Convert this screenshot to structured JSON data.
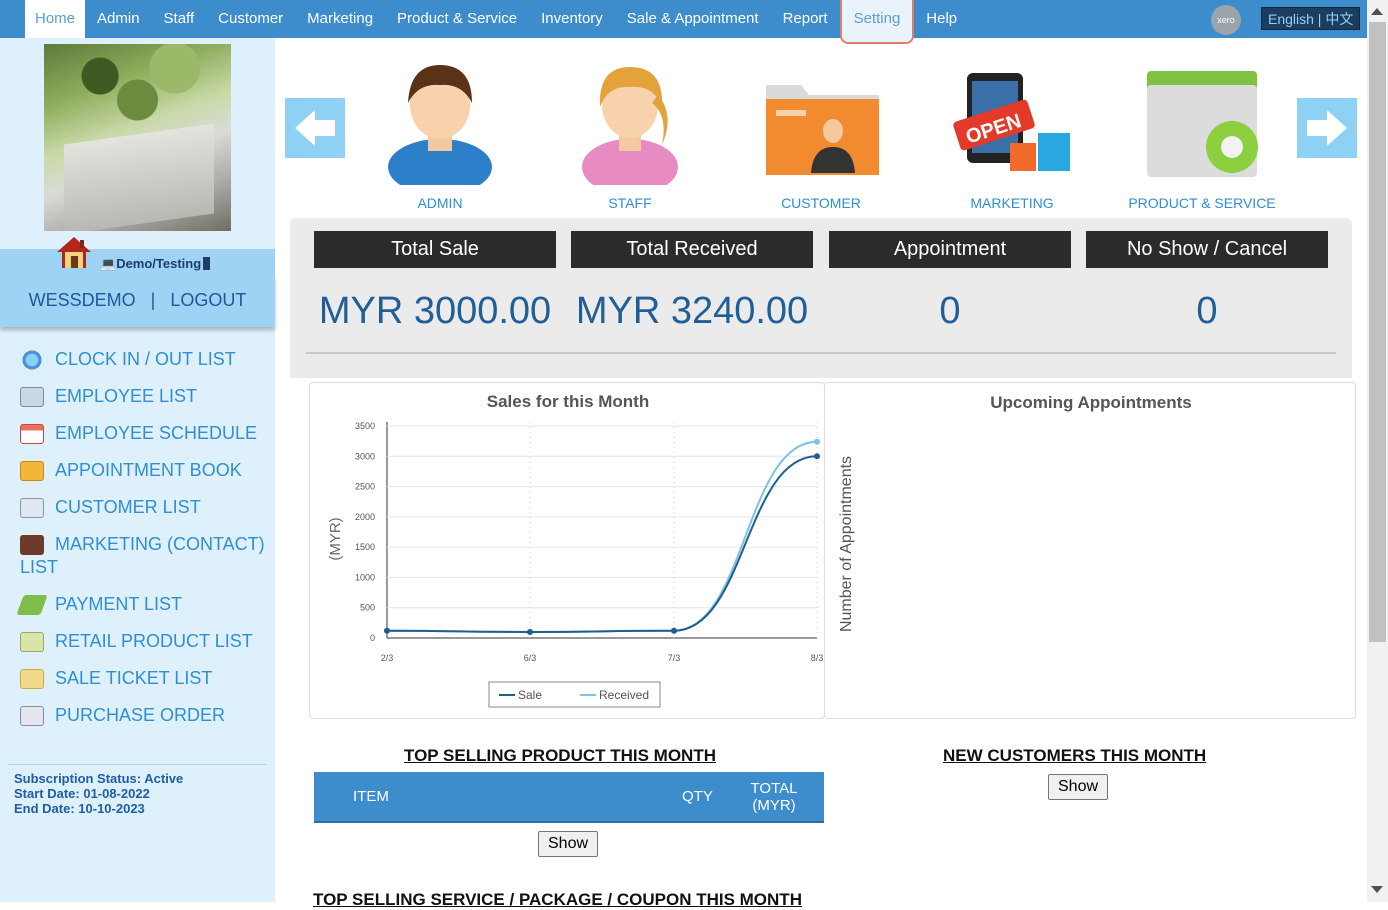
{
  "nav": {
    "items": [
      "Home",
      "Admin",
      "Staff",
      "Customer",
      "Marketing",
      "Product & Service",
      "Inventory",
      "Sale & Appointment",
      "Report",
      "Setting",
      "Help"
    ],
    "xero": "xero",
    "language": "English | 中文"
  },
  "sidebar": {
    "demo_label": "Demo/Testing",
    "username": "WESSDEMO",
    "separator": "|",
    "logout": "LOGOUT",
    "menu": [
      {
        "label": "CLOCK IN / OUT LIST",
        "icon": "clock-icon"
      },
      {
        "label": "EMPLOYEE LIST",
        "icon": "employee-list-icon"
      },
      {
        "label": "EMPLOYEE SCHEDULE",
        "icon": "calendar-icon"
      },
      {
        "label": "APPOINTMENT BOOK",
        "icon": "appointment-book-icon"
      },
      {
        "label": "CUSTOMER LIST",
        "icon": "customer-list-icon"
      },
      {
        "label": "MARKETING (CONTACT) LIST",
        "icon": "contact-book-icon"
      },
      {
        "label": "PAYMENT LIST",
        "icon": "payment-icon"
      },
      {
        "label": "RETAIL PRODUCT LIST",
        "icon": "product-box-icon"
      },
      {
        "label": "SALE TICKET LIST",
        "icon": "ticket-icon"
      },
      {
        "label": "PURCHASE ORDER",
        "icon": "purchase-order-icon"
      }
    ],
    "subscription_status": "Subscription Status: Active",
    "start_date": "Start Date: 01-08-2022",
    "end_date": "End Date: 10-10-2023"
  },
  "carousel": {
    "tiles": [
      "ADMIN",
      "STAFF",
      "CUSTOMER",
      "MARKETING",
      "PRODUCT & SERVICE"
    ]
  },
  "summary": {
    "headers": [
      "Total Sale",
      "Total Received",
      "Appointment",
      "No Show / Cancel"
    ],
    "values": [
      "MYR 3000.00",
      "MYR 3240.00",
      "0",
      "0"
    ]
  },
  "charts": {
    "sales_title": "Sales for this Month",
    "appointments_title": "Upcoming Appointments",
    "appointments_ylabel": "Number of Appointments"
  },
  "chart_data": {
    "type": "line",
    "title": "Sales for this Month",
    "ylabel": "(MYR)",
    "xlabel": "",
    "ylim": [
      0,
      3500
    ],
    "yticks": [
      0,
      500,
      1000,
      1500,
      2000,
      2500,
      3000,
      3500
    ],
    "categories": [
      "2/3",
      "6/3",
      "7/3",
      "8/3"
    ],
    "series": [
      {
        "name": "Sale",
        "values": [
          120,
          100,
          120,
          3000
        ],
        "color": "#1f5f8e"
      },
      {
        "name": "Received",
        "values": [
          120,
          100,
          120,
          3240
        ],
        "color": "#7fc2e6"
      }
    ],
    "legend": "bottom"
  },
  "bottom": {
    "top_product_title": "TOP SELLING PRODUCT THIS MONTH",
    "table_cols": [
      "ITEM",
      "QTY",
      "TOTAL (MYR)"
    ],
    "show": "Show",
    "new_customers_title": "NEW CUSTOMERS THIS MONTH",
    "top_service_title": "TOP SELLING SERVICE / PACKAGE / COUPON THIS MONTH"
  }
}
